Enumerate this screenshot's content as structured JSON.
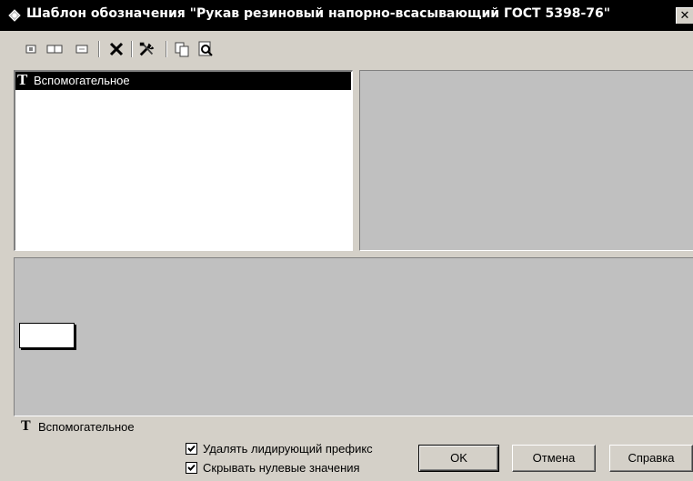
{
  "window": {
    "title": "Шаблон обозначения \"Рукав резиновый напорно-всасывающий ГОСТ 5398-76\"",
    "close_glyph": "✕",
    "title_icon": "template-icon"
  },
  "toolbar": {
    "icons": [
      "field-small-icon",
      "field-wide-icon",
      "field-medium-icon",
      "delete-icon",
      "tools-icon",
      "copy-icon",
      "preview-icon"
    ]
  },
  "tree": {
    "items": [
      {
        "glyph": "T",
        "label": "Вспомогательное",
        "selected": true
      }
    ]
  },
  "status": {
    "glyph": "T",
    "label": "Вспомогательное"
  },
  "options": {
    "remove_leading_prefix": {
      "label": "Удалять лидирующий префикс",
      "checked": true
    },
    "hide_zero_values": {
      "label": "Скрывать нулевые значения",
      "checked": true
    }
  },
  "buttons": {
    "ok": "OK",
    "cancel": "Отмена",
    "help": "Справка"
  },
  "colors": {
    "face": "#d4d0c8",
    "panel": "#c0c0c0",
    "title_bg": "#000000",
    "selection": "#000000"
  }
}
